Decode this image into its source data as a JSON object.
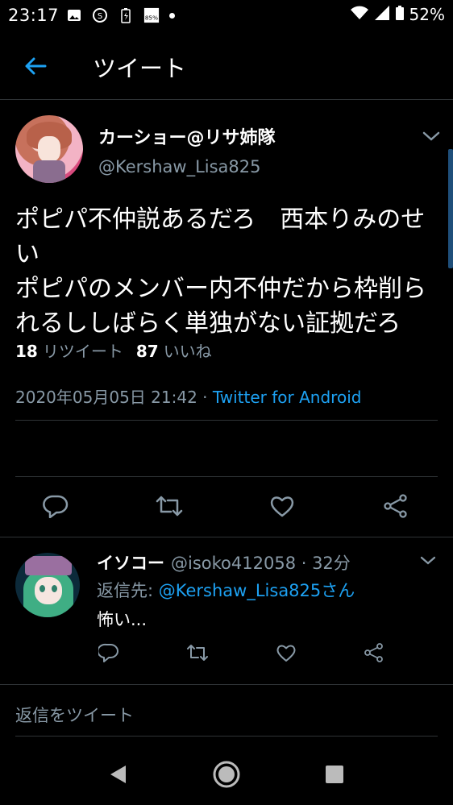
{
  "status_bar": {
    "time": "23:17",
    "battery": "52%",
    "left_icons": [
      "image-icon",
      "sync-icon",
      "battery-saver-icon",
      "badge-icon"
    ],
    "right_icons": [
      "wifi-icon",
      "signal-icon",
      "battery-icon"
    ]
  },
  "app_bar": {
    "title": "ツイート",
    "back_icon": "back-arrow-icon"
  },
  "main_tweet": {
    "display_name": "カーショー@リサ姉隊",
    "handle": "@Kershaw_Lisa825",
    "text": "ポピパ不仲説あるだろ　西本りみのせい\nポピパのメンバー内不仲だから枠削られるししばらく単独がない証拠だろ",
    "timestamp": "2020年05月05日 21:42",
    "separator": " · ",
    "source": "Twitter for Android",
    "retweets_count": "18",
    "retweets_label": "リツイート",
    "likes_count": "87",
    "likes_label": "いいね"
  },
  "reply": {
    "display_name": "イソコー",
    "handle": "@isoko412058 · 32分",
    "reply_to_prefix": "返信先: ",
    "reply_to_handle": "@Kershaw_Lisa825さん",
    "text": "怖い..."
  },
  "compose": {
    "placeholder": "返信をツイート"
  },
  "colors": {
    "background": "#000000",
    "accent": "#1da1f2",
    "secondary_text": "#8899a6",
    "divider": "#2f3336"
  }
}
